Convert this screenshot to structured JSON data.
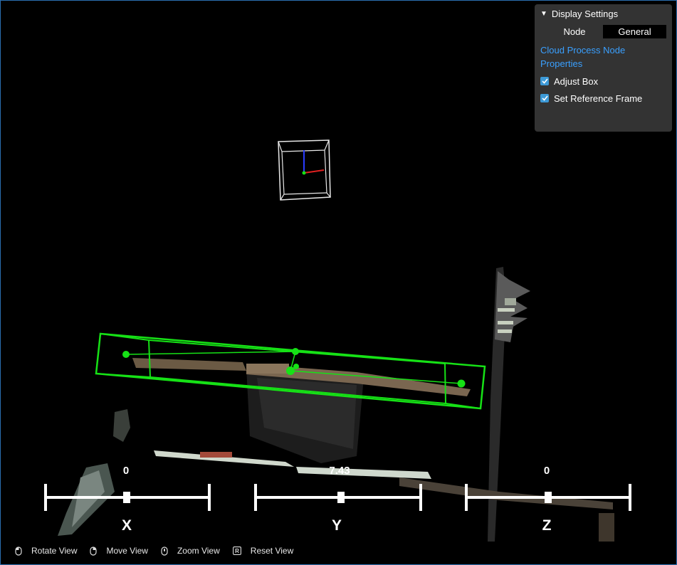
{
  "panel": {
    "title": "Display Settings",
    "node_label": "Node",
    "node_value": "General",
    "link_text": "Cloud Process Node Properties",
    "checkboxes": [
      {
        "label": "Adjust Box",
        "checked": true
      },
      {
        "label": "Set Reference Frame",
        "checked": true
      }
    ]
  },
  "sliders": {
    "x": {
      "axis": "X",
      "value": "0"
    },
    "y": {
      "axis": "Y",
      "value": "7.43"
    },
    "z": {
      "axis": "Z",
      "value": "0"
    }
  },
  "hints": [
    {
      "icon": "mouse-left-icon",
      "label": "Rotate View"
    },
    {
      "icon": "mouse-right-icon",
      "label": "Move View"
    },
    {
      "icon": "mouse-wheel-icon",
      "label": "Zoom View"
    },
    {
      "icon": "r-key-icon",
      "label": "Reset View"
    }
  ],
  "colors": {
    "box": "#16e216",
    "accent": "#3aa0ff",
    "panel_bg": "#333333"
  }
}
